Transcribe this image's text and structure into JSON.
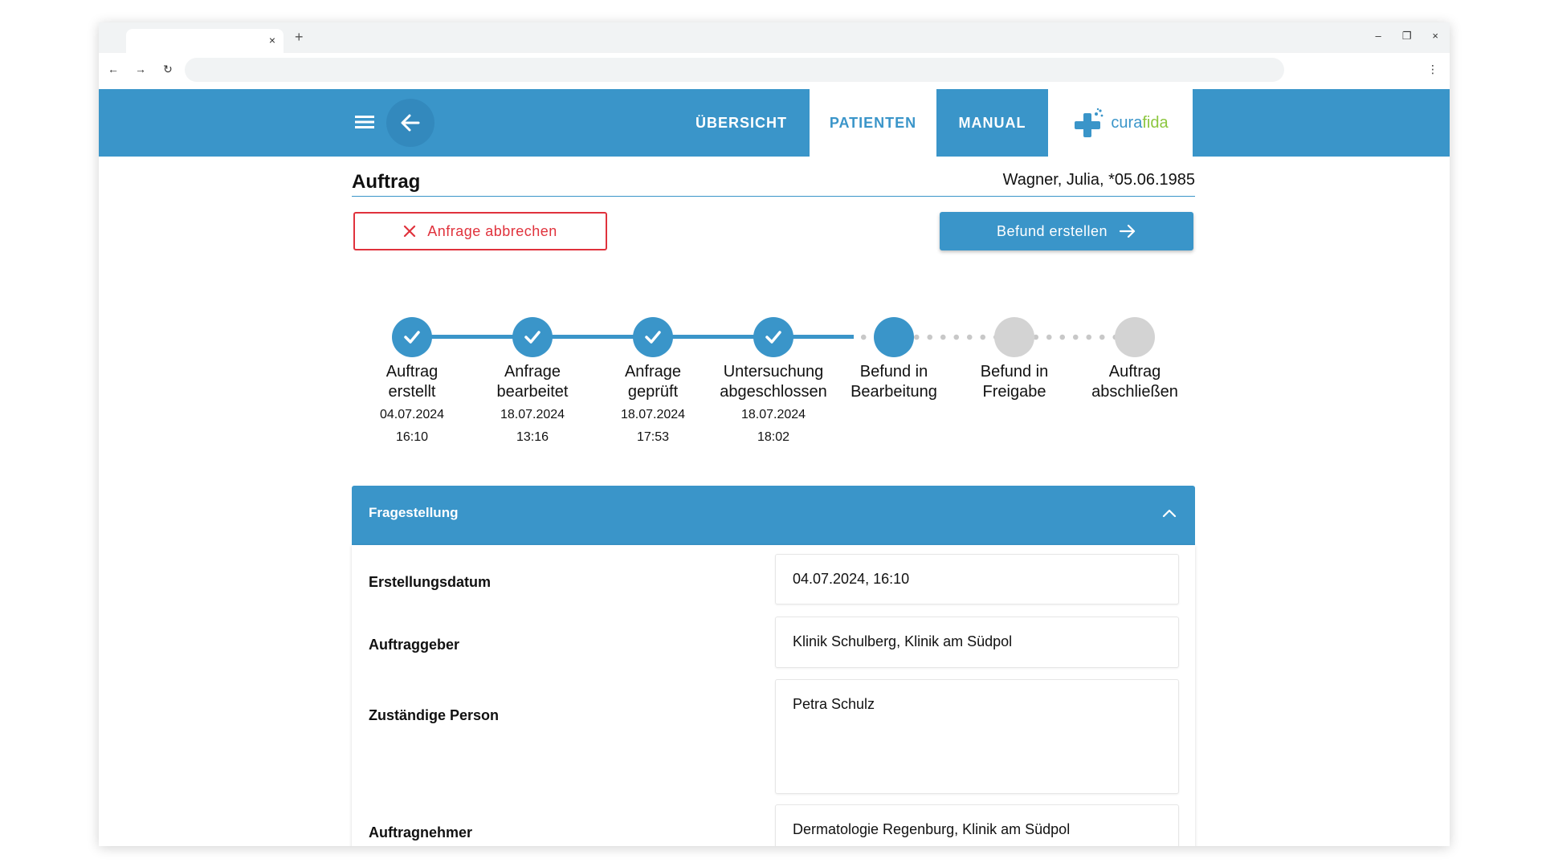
{
  "browser": {
    "tab_close": "×",
    "new_tab": "+",
    "minimize": "–",
    "restore": "❐",
    "close": "×",
    "back": "←",
    "forward": "→",
    "reload": "↻",
    "menu": "⋮"
  },
  "header": {
    "nav": {
      "overview": "ÜBERSICHT",
      "patients": "PATIENTEN",
      "manual": "MANUAL"
    },
    "logo": {
      "part1": "cura",
      "part2": "fida"
    },
    "colors": {
      "primary": "#3a95c9",
      "logo_green": "#8cc63f"
    }
  },
  "page": {
    "title": "Auftrag",
    "patient": "Wagner, Julia, *05.06.1985",
    "cancel_label": "Anfrage abbrechen",
    "primary_label": "Befund erstellen"
  },
  "steps": [
    {
      "line1": "Auftrag",
      "line2": "erstellt",
      "date": "04.07.2024",
      "time": "16:10",
      "status": "done"
    },
    {
      "line1": "Anfrage",
      "line2": "bearbeitet",
      "date": "18.07.2024",
      "time": "13:16",
      "status": "done"
    },
    {
      "line1": "Anfrage",
      "line2": "geprüft",
      "date": "18.07.2024",
      "time": "17:53",
      "status": "done"
    },
    {
      "line1": "Untersuchung",
      "line2": "abgeschlossen",
      "date": "18.07.2024",
      "time": "18:02",
      "status": "done"
    },
    {
      "line1": "Befund in",
      "line2": "Bearbeitung",
      "date": "",
      "time": "",
      "status": "current"
    },
    {
      "line1": "Befund in",
      "line2": "Freigabe",
      "date": "",
      "time": "",
      "status": "todo"
    },
    {
      "line1": "Auftrag",
      "line2": "abschließen",
      "date": "",
      "time": "",
      "status": "todo"
    }
  ],
  "panel": {
    "title": "Fragestellung",
    "fields": [
      {
        "label": "Erstellungsdatum",
        "value": "04.07.2024, 16:10"
      },
      {
        "label": "Auftraggeber",
        "value": "Klinik Schulberg, Klinik am Südpol"
      },
      {
        "label": "Zuständige Person",
        "value": "Petra Schulz"
      },
      {
        "label": "Auftragnehmer",
        "value": "Dermatologie Regenburg, Klinik am Südpol"
      }
    ]
  }
}
